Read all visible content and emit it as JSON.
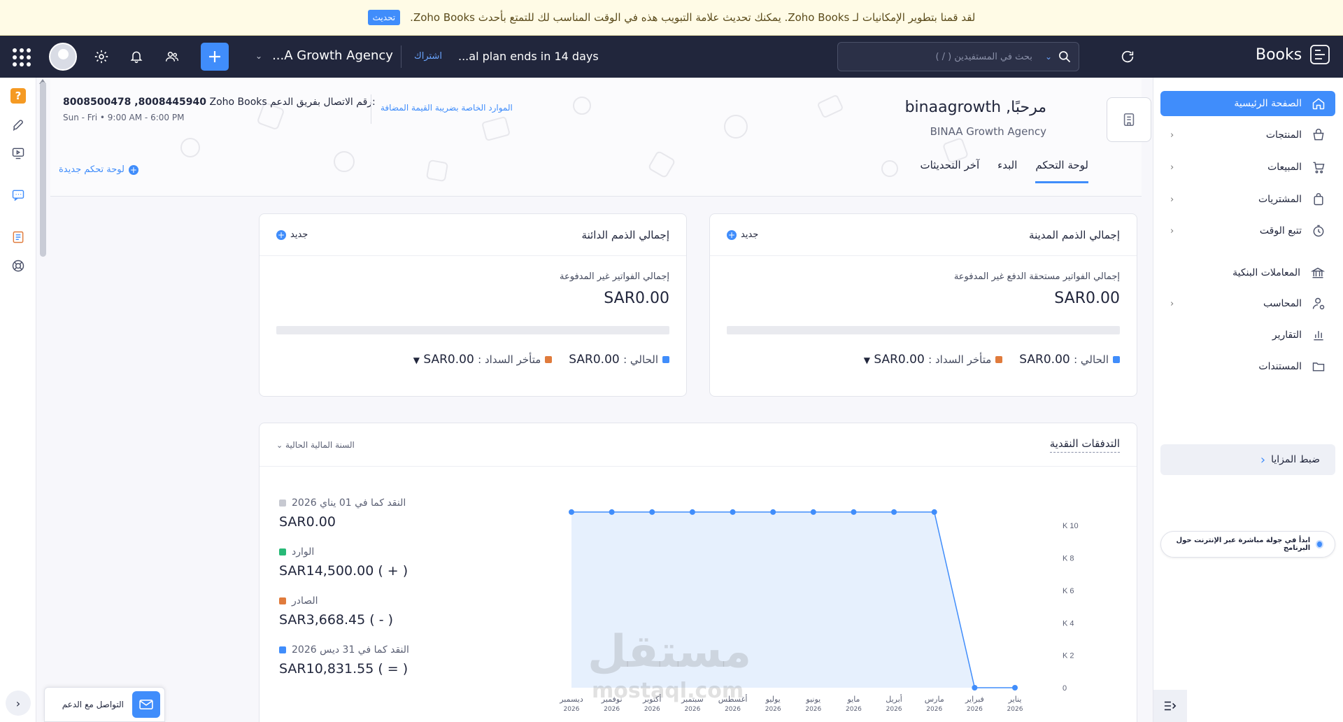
{
  "announcement": {
    "text": "لقد قمنا بتطوير الإمكانيات لـ Zoho Books. يمكنك تحديث علامة التبويب هذه في الوقت المناسب لك للتمتع بأحدث Zoho Books.",
    "button": "تحديث"
  },
  "topbar": {
    "org_name": "...A Growth Agency",
    "subscribe": "اشتراك",
    "trial": "...al plan ends in 14 days",
    "search_placeholder": "بحث في المستفيدين ( / )",
    "brand": "Books"
  },
  "nav": {
    "items": [
      {
        "label": "الصفحة الرئيسية",
        "icon": "home-icon"
      },
      {
        "label": "المنتجات",
        "icon": "basket-icon"
      },
      {
        "label": "المبيعات",
        "icon": "cart-icon"
      },
      {
        "label": "المشتريات",
        "icon": "bag-icon"
      },
      {
        "label": "تتبع الوقت",
        "icon": "clock-icon"
      },
      {
        "label": "المعاملات البنكية",
        "icon": "bank-icon"
      },
      {
        "label": "المحاسب",
        "icon": "accountant-icon"
      },
      {
        "label": "التقارير",
        "icon": "chart-icon"
      },
      {
        "label": "المستندات",
        "icon": "folder-icon"
      }
    ],
    "setup": "ضبط المزايا",
    "tour": "ابدأ في جولة مباشرة عبر الإنترنت حول البرنامج"
  },
  "header": {
    "welcome_prefix": "مرحبًا,",
    "user": "binaagrowth",
    "org": "BINAA Growth Agency",
    "tabs": [
      "لوحة التحكم",
      "البدء",
      "آخر التحديثات"
    ],
    "support_label": "Zoho Books رقم الاتصال بفريق الدعم:",
    "support_phones": "8008500478 ,8008445940",
    "hours": "Sun - Fri • 9:00 AM - 6:00 PM",
    "vat_link": "الموارد الخاصة بضريبة القيمة المضافة",
    "new_dashboard": "لوحة تحكم جديدة"
  },
  "receivables": {
    "title": "إجمالي الذمم المدينة",
    "new": "جديد",
    "label": "إجمالي الفواتير مستحقة الدفع غير المدفوعة",
    "amount": "SAR0.00",
    "current_label": "الحالي :",
    "current": "SAR0.00",
    "overdue_label": "متأخر السداد :",
    "overdue": "SAR0.00"
  },
  "payables": {
    "title": "إجمالي الذمم الدائنة",
    "new": "جديد",
    "label": "إجمالي الفواتير غير المدفوعة",
    "amount": "SAR0.00",
    "current_label": "الحالي :",
    "current": "SAR0.00",
    "overdue_label": "متأخر السداد :",
    "overdue": "SAR0.00"
  },
  "cashflow": {
    "title": "التدفقات النقدية",
    "period": "السنة المالية الحالية",
    "legend": [
      {
        "label": "النقد كما في 01 يناي 2026",
        "value": "SAR0.00",
        "color": "#c7c9d1"
      },
      {
        "label": "الوارد",
        "value": "SAR14,500.00 ( + )",
        "color": "#27b977"
      },
      {
        "label": "الصادر",
        "value": "SAR3,668.45 ( - )",
        "color": "#e07b3c"
      },
      {
        "label": "النقد كما في 31 ديس 2026",
        "value": "SAR10,831.55 ( = )",
        "color": "#408dfb"
      }
    ]
  },
  "chart_data": {
    "type": "area",
    "categories": [
      "يناير 2026",
      "فبراير 2026",
      "مارس 2026",
      "أبريل 2026",
      "مايو 2026",
      "يونيو 2026",
      "يوليو 2026",
      "أغسطس 2026",
      "سبتمبر 2026",
      "أكتوبر 2026",
      "نوفمبر 2026",
      "ديسمبر 2026"
    ],
    "x_direction": "right-to-left",
    "series": [
      {
        "values": [
          0,
          0,
          10831.55,
          10831.55,
          10831.55,
          10831.55,
          10831.55,
          10831.55,
          10831.55,
          10831.55,
          10831.55,
          10831.55
        ]
      }
    ],
    "yticks": [
      "0",
      "K 2",
      "K 4",
      "K 6",
      "K 8",
      "K 10"
    ],
    "ylim": [
      0,
      11000
    ],
    "color": "#408dfb"
  },
  "chat": {
    "label": "التواصل مع الدعم"
  },
  "watermark": {
    "ar": "مستقل",
    "en": "mostaql.com"
  }
}
